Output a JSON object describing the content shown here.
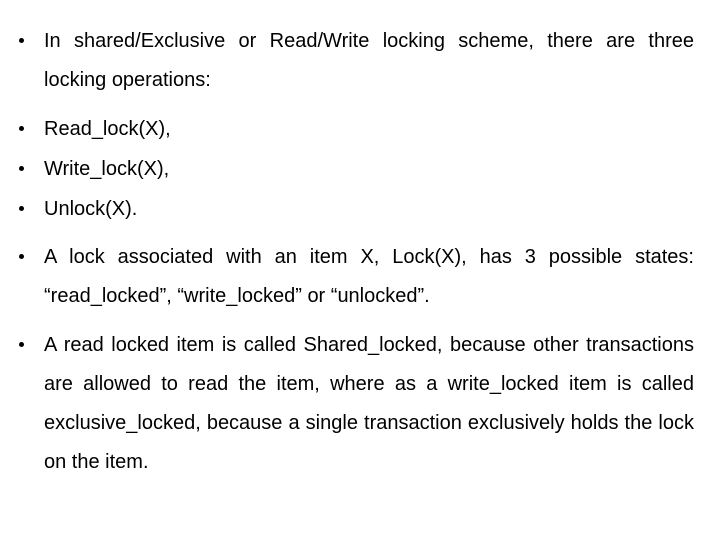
{
  "slide": {
    "background_color": "#ffffff",
    "text_color": "#000000",
    "bullet_glyph": "•",
    "bullets": [
      {
        "id": "locking-scheme-intro",
        "text": "In shared/Exclusive or Read/Write locking scheme, there are three locking operations:"
      },
      {
        "id": "read-lock",
        "text": "Read_lock(X),"
      },
      {
        "id": "write-lock",
        "text": "Write_lock(X),"
      },
      {
        "id": "unlock",
        "text": "Unlock(X)."
      },
      {
        "id": "lock-states",
        "text": "A lock associated with an item X, Lock(X), has 3 possible states: “read_locked”, “write_locked” or “unlocked”."
      },
      {
        "id": "shared-vs-exclusive",
        "text": "A read locked item is called Shared_locked, because other transactions are allowed to read the item, where as a write_locked item is called exclusive_locked, because a single transaction exclusively holds the lock on the item."
      }
    ]
  }
}
